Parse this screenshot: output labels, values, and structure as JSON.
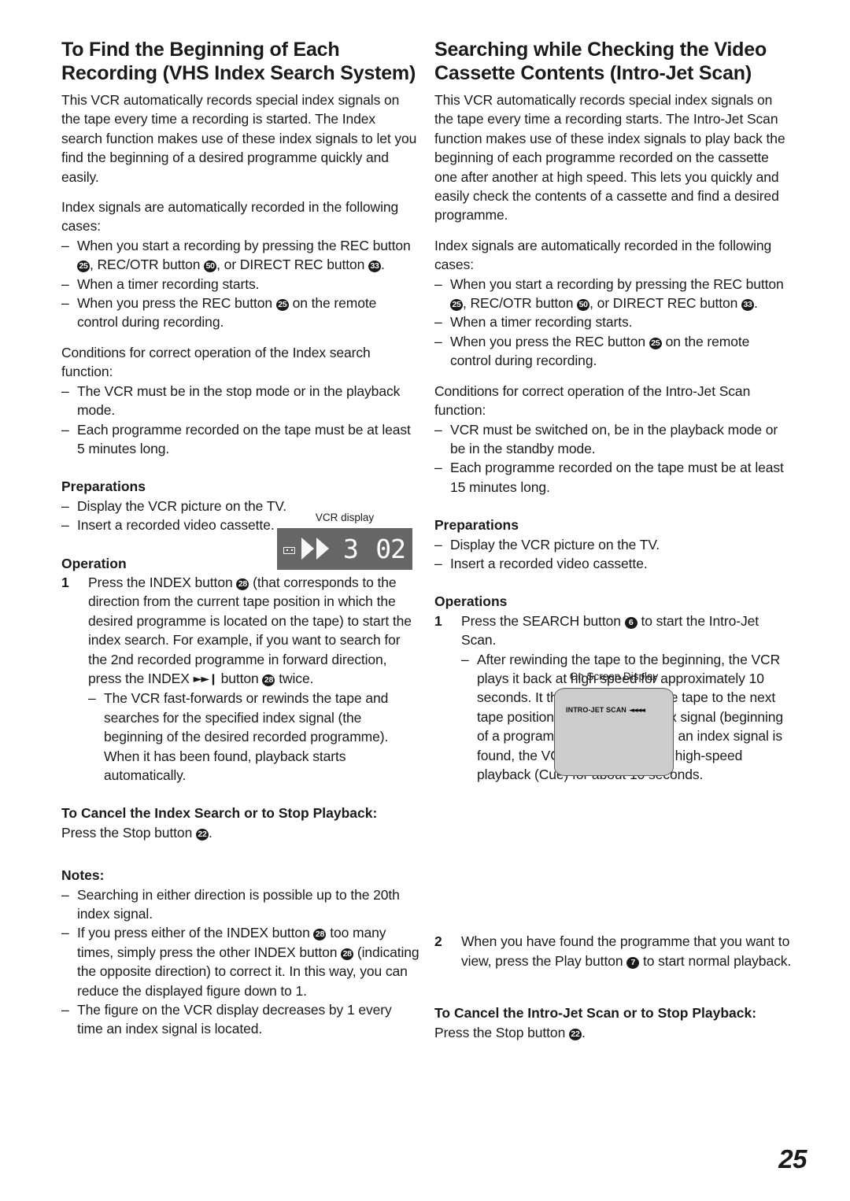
{
  "page": {
    "number": "25"
  },
  "left_column": {
    "title": "To Find the Beginning of Each Recording (VHS Index Search System)",
    "intro": "This VCR automatically records special index signals on the tape every time a recording is started. The Index search function makes use of these index signals to let you find the beginning of a desired programme quickly and easily.",
    "index_cases_lead": "Index signals are automatically recorded in the following cases:",
    "index_cases": {
      "case1_a": "When you start a recording by pressing the REC button ",
      "case1_ref1": "25",
      "case1_b": ", REC/OTR button ",
      "case1_ref2": "50",
      "case1_c": ", or DIRECT REC button ",
      "case1_ref3": "33",
      "case1_d": ".",
      "case2": "When a timer recording starts.",
      "case3_a": "When you press the REC button ",
      "case3_ref": "25",
      "case3_b": " on the remote control during recording."
    },
    "conditions_lead": "Conditions for correct operation of the Index search function:",
    "conditions": [
      "The VCR must be in the stop mode or in the playback mode.",
      "Each programme recorded on the tape must be at least 5 minutes long."
    ],
    "preparations_head": "Preparations",
    "preparations": [
      "Display the VCR picture on the TV.",
      "Insert a recorded video cassette."
    ],
    "operation_head": "Operation",
    "step1": {
      "num": "1",
      "text_a": "Press the INDEX button ",
      "ref1": "28",
      "text_b": " (that corresponds to the direction from the current tape position in which the desired programme is located on the tape) to start the index search.",
      "text_c": "For example, if you want to search for the 2nd recorded programme in forward direction, press the INDEX ",
      "symbol": "►►❙",
      "text_d": " button ",
      "ref2": "28",
      "text_e": " twice.",
      "sub_dash": "The VCR fast-forwards or rewinds the tape and searches for the specified index signal (the beginning of the desired recorded programme). When it has been found, playback starts automatically."
    },
    "cancel_head": "To Cancel the Index Search or to Stop Playback:",
    "cancel_text_a": "Press the Stop button ",
    "cancel_ref": "22",
    "cancel_text_b": ".",
    "notes_head": "Notes:",
    "notes": {
      "note1": "Searching in either direction is possible up to the 20th index signal.",
      "note2_a": "If you press either of the INDEX button ",
      "note2_ref1": "28",
      "note2_b": " too many times, simply press the other INDEX button ",
      "note2_ref2": "28",
      "note2_c": " (indicating the opposite direction) to correct it. In this way, you can reduce the displayed figure down to 1.",
      "note3": "The figure on the VCR display decreases by 1 every time an index signal is located."
    },
    "vcr_display": {
      "caption": "VCR display",
      "cassette_icon": "cassette-icon",
      "play_icon": "double-play-triangles",
      "counter": "3",
      "index_number": "02"
    }
  },
  "right_column": {
    "title": "Searching while Checking the Video Cassette Contents (Intro-Jet Scan)",
    "intro": "This VCR automatically records special index signals on the tape every time a recording starts. The Intro-Jet Scan function makes use of these index signals to play back the beginning of each programme recorded on the cassette one after another at high speed. This lets you quickly and easily check the contents of a cassette and find a desired programme.",
    "index_cases_lead": "Index signals are automatically recorded in the following cases:",
    "index_cases": {
      "case1_a": "When you start a recording by pressing the REC button ",
      "case1_ref1": "25",
      "case1_b": ", REC/OTR button ",
      "case1_ref2": "50",
      "case1_c": ", or DIRECT REC button ",
      "case1_ref3": "33",
      "case1_d": ".",
      "case2": "When a timer recording starts.",
      "case3_a": "When you press the REC button ",
      "case3_ref": "25",
      "case3_b": " on the remote control during recording."
    },
    "conditions_lead": "Conditions for correct operation of the Intro-Jet Scan function:",
    "conditions": [
      "VCR must be switched on, be in the playback mode or be in the standby mode.",
      "Each programme recorded on the tape must be at least 15 minutes long."
    ],
    "preparations_head": "Preparations",
    "preparations": [
      "Display the VCR picture on the TV.",
      "Insert a recorded video cassette."
    ],
    "operations_head": "Operations",
    "step1": {
      "num": "1",
      "text_a": "Press the SEARCH button ",
      "ref": "6",
      "text_b": " to start the Intro-Jet Scan.",
      "sub_dash": "After rewinding the tape to the beginning, the VCR plays it back at high speed for approximately 10 seconds. It then fast-forwards the tape to the next tape position marked by an index signal (beginning of a programme), and every time an index signal is found, the VCR switches over to high-speed playback (Cue) for about 10 seconds."
    },
    "step2": {
      "num": "2",
      "text_a": "When you have found the programme that you want to view, press the Play button ",
      "ref": "7",
      "text_b": " to start normal playback."
    },
    "cancel_head": "To Cancel the Intro-Jet Scan or to Stop Playback:",
    "cancel_text_a": "Press the Stop button ",
    "cancel_ref": "22",
    "cancel_text_b": ".",
    "osd": {
      "caption": "On Screen Display",
      "text": "INTRO-JET SCAN",
      "arrows": "◄◄◄◄"
    }
  }
}
